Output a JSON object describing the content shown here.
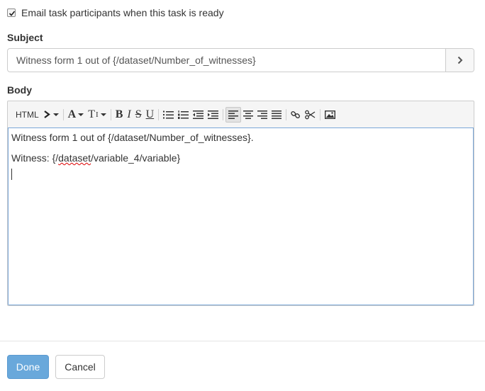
{
  "notify": {
    "checked": true,
    "label": "Email task participants when this task is ready"
  },
  "subject": {
    "label": "Subject",
    "value": "Witness form 1 out of {/dataset/Number_of_witnesses}",
    "button_icon": "chevron-right-icon"
  },
  "body": {
    "label": "Body",
    "toolbar": {
      "html_label": "HTML",
      "font_size_label": "A",
      "text_style_label": "T",
      "bold_label": "B",
      "italic_label": "I",
      "strike_label": "S",
      "underline_label": "U",
      "icons": [
        "expand-icon",
        "font-size-icon",
        "text-transform-icon",
        "bold-icon",
        "italic-icon",
        "strikethrough-icon",
        "underline-icon",
        "bullet-list-icon",
        "numbered-list-icon",
        "outdent-icon",
        "indent-icon",
        "align-left-icon",
        "align-center-icon",
        "align-right-icon",
        "justify-icon",
        "link-icon",
        "unlink-icon",
        "image-icon"
      ]
    },
    "line1": "Witness form 1 out of {/dataset/Number_of_witnesses}.",
    "line2_prefix": "Witness: {/",
    "line2_spell": "dataset",
    "line2_suffix": "/variable_4/variable}"
  },
  "actions": {
    "done_label": "Done",
    "cancel_label": "Cancel"
  }
}
